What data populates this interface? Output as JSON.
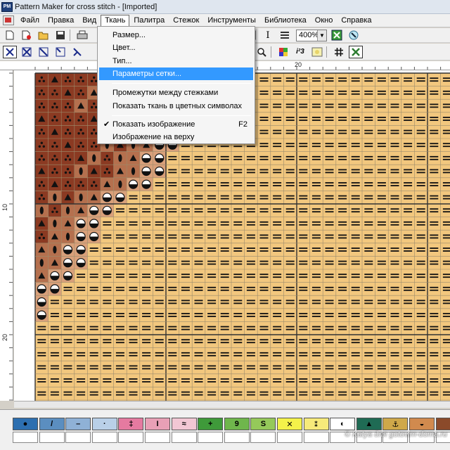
{
  "window": {
    "title": "Pattern Maker for cross stitch - [Imported]",
    "app_icon": "PM"
  },
  "menubar": {
    "items": [
      "Файл",
      "Правка",
      "Вид",
      "Ткань",
      "Палитра",
      "Стежок",
      "Инструменты",
      "Библиотека",
      "Окно",
      "Справка"
    ],
    "open_item": "Ткань"
  },
  "toolbar": {
    "zoom_value": "400%",
    "italic_glyph": "I",
    "sort_glyph": "i²3"
  },
  "dropdown": {
    "items": [
      {
        "label": "Размер...",
        "shortcut": "",
        "checked": false,
        "highlighted": false
      },
      {
        "label": "Цвет...",
        "shortcut": "",
        "checked": false,
        "highlighted": false
      },
      {
        "label": "Тип...",
        "shortcut": "",
        "checked": false,
        "highlighted": false
      },
      {
        "label": "Параметры сетки...",
        "shortcut": "",
        "checked": false,
        "highlighted": true
      },
      {
        "label": "Промежутки между стежками",
        "shortcut": "",
        "checked": false,
        "highlighted": false
      },
      {
        "label": "Показать ткань в цветных символах",
        "shortcut": "",
        "checked": false,
        "highlighted": false
      },
      {
        "label": "Показать изображение",
        "shortcut": "F2",
        "checked": true,
        "highlighted": false
      },
      {
        "label": "Изображение на верху",
        "shortcut": "",
        "checked": false,
        "highlighted": false
      }
    ]
  },
  "rulers": {
    "top_label": "20",
    "left_labels": [
      "10",
      "20"
    ]
  },
  "palette": {
    "swatches": [
      {
        "color": "#2d6fb0",
        "symbol": "●"
      },
      {
        "color": "#5b8ec0",
        "symbol": "/"
      },
      {
        "color": "#8fb1d6",
        "symbol": "–"
      },
      {
        "color": "#b9d0e8",
        "symbol": "·"
      },
      {
        "color": "#e57aa0",
        "symbol": "‡"
      },
      {
        "color": "#e8a0b6",
        "symbol": "I"
      },
      {
        "color": "#f2c7d4",
        "symbol": "≈"
      },
      {
        "color": "#3f9a3a",
        "symbol": "+"
      },
      {
        "color": "#6fb64c",
        "symbol": "9"
      },
      {
        "color": "#95c95a",
        "symbol": "S"
      },
      {
        "color": "#f4f24a",
        "symbol": "✕"
      },
      {
        "color": "#f7ea7a",
        "symbol": "⁑"
      },
      {
        "color": "#ffffff",
        "symbol": "◐"
      },
      {
        "color": "#1f6b54",
        "symbol": "▲"
      },
      {
        "color": "#cfa84a",
        "symbol": "⚓"
      },
      {
        "color": "#d18a4e",
        "symbol": "◒"
      },
      {
        "color": "#8b4a2a",
        "symbol": ""
      }
    ]
  },
  "pattern": {
    "colors": {
      "dark_brown": "#8b3a22",
      "brown": "#b5704e",
      "light_brown": "#d9a07a",
      "fabric": "#f2c77e"
    },
    "symbols": {
      "dark_brown": "three-dots",
      "brown": "triangle-oval",
      "light_brown": "half-circle",
      "fabric": "double-dash"
    }
  },
  "watermark": "© Katya для gotovim-doma.ru"
}
